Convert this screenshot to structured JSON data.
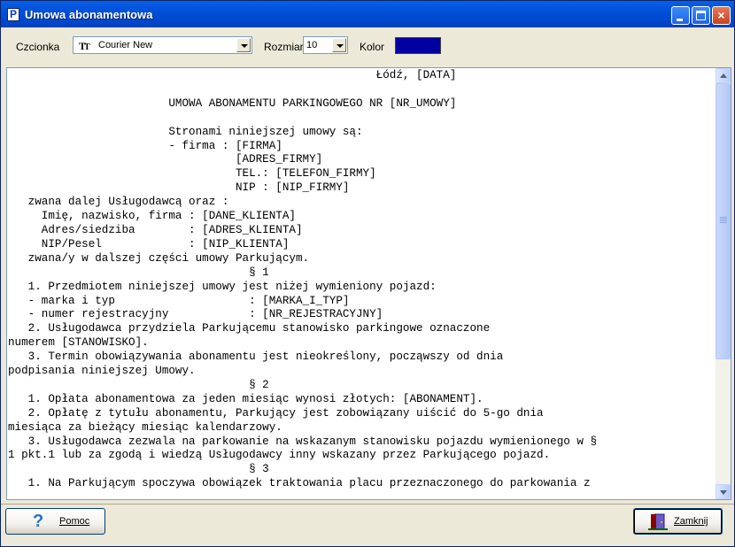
{
  "window": {
    "title": "Umowa abonamentowa",
    "app_icon_letter": "P",
    "controls": {
      "minimize": "minimize-icon",
      "maximize": "maximize-icon",
      "close": "×"
    }
  },
  "toolbar": {
    "font_label": "Czcionka",
    "font_value": "Courier New",
    "font_icon": "TrueType-font-icon",
    "size_label": "Rozmiar",
    "size_value": "10",
    "color_label": "Kolor",
    "color_value": "#0000A0"
  },
  "document": {
    "lines": [
      "                                                       Łódź, [DATA]",
      "",
      "                        UMOWA ABONAMENTU PARKINGOWEGO NR [NR_UMOWY]",
      "",
      "                        Stronami niniejszej umowy są:",
      "                        - firma : [FIRMA]",
      "                                  [ADRES_FIRMY]",
      "                                  TEL.: [TELEFON_FIRMY]",
      "                                  NIP : [NIP_FIRMY]",
      "   zwana dalej Usługodawcą oraz :",
      "     Imię, nazwisko, firma : [DANE_KLIENTA]",
      "     Adres/siedziba        : [ADRES_KLIENTA]",
      "     NIP/Pesel             : [NIP_KLIENTA]",
      "   zwana/y w dalszej części umowy Parkującym.",
      "                                    § 1",
      "   1. Przedmiotem niniejszej umowy jest niżej wymieniony pojazd:",
      "   - marka i typ                    : [MARKA_I_TYP]",
      "   - numer rejestracyjny            : [NR_REJESTRACYJNY]",
      "   2. Usługodawca przydziela Parkującemu stanowisko parkingowe oznaczone",
      "numerem [STANOWISKO].",
      "   3. Termin obowiązywania abonamentu jest nieokreślony, począwszy od dnia",
      "podpisania niniejszej Umowy.",
      "                                    § 2",
      "   1. Opłata abonamentowa za jeden miesiąc wynosi złotych: [ABONAMENT].",
      "   2. Opłatę z tytułu abonamentu, Parkujący jest zobowiązany uiścić do 5-go dnia",
      "miesiąca za bieżący miesiąc kalendarzowy.",
      "   3. Usługodawca zezwala na parkowanie na wskazanym stanowisku pojazdu wymienionego w §",
      "1 pkt.1 lub za zgodą i wiedzą Usługodawcy inny wskazany przez Parkującego pojazd.",
      "                                    § 3",
      "   1. Na Parkującym spoczywa obowiązek traktowania placu przeznaczonego do parkowania z"
    ]
  },
  "scrollbar": {
    "up": "scroll-up-arrow-icon",
    "down": "scroll-down-arrow-icon"
  },
  "buttons": {
    "help_label": "Pomoc",
    "help_icon": "question-mark-icon",
    "close_label": "Zamknij",
    "close_icon": "exit-door-icon"
  }
}
